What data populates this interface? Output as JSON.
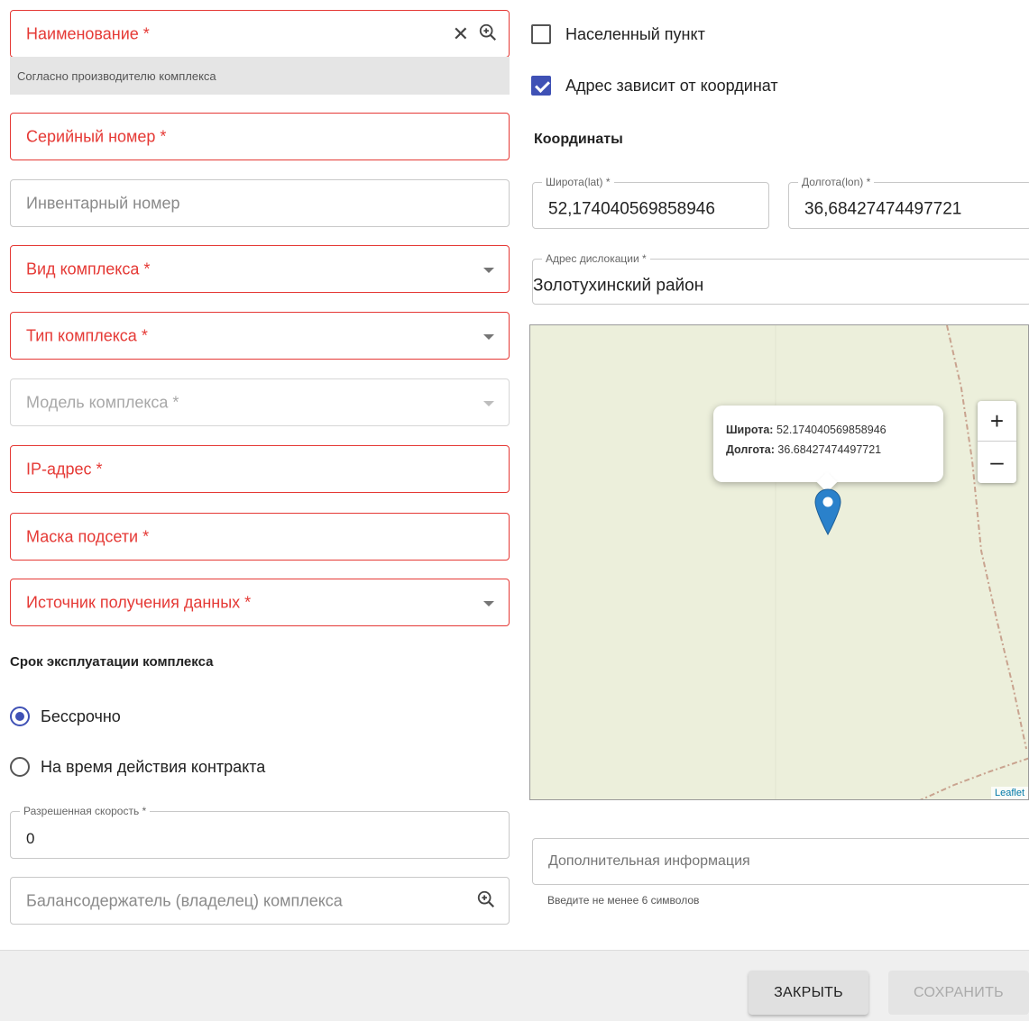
{
  "left": {
    "name": {
      "placeholder": "Наименование *",
      "clear_icon": "close-icon",
      "search_icon": "zoom-in-icon"
    },
    "name_helper": "Согласно производителю комплекса",
    "serial": {
      "placeholder": "Серийный номер *"
    },
    "inventory": {
      "placeholder": "Инвентарный номер"
    },
    "kind": {
      "placeholder": "Вид комплекса *"
    },
    "type": {
      "placeholder": "Тип комплекса *"
    },
    "model": {
      "placeholder": "Модель комплекса *"
    },
    "ip": {
      "placeholder": "IP-адрес *"
    },
    "mask": {
      "placeholder": "Маска подсети *"
    },
    "source": {
      "placeholder": "Источник получения данных *"
    },
    "term_title": "Срок эксплуатации комплекса",
    "term_options": [
      {
        "label": "Бессрочно",
        "selected": true
      },
      {
        "label": "На время действия контракта",
        "selected": false
      }
    ],
    "speed": {
      "label": "Разрешенная скорость *",
      "value": "0"
    },
    "owner": {
      "placeholder": "Балансодержатель (владелец) комплекса",
      "search_icon": "zoom-in-icon"
    }
  },
  "right": {
    "locality": {
      "label": "Населенный пункт",
      "checked": false
    },
    "address_by_coords": {
      "label": "Адрес зависит от координат",
      "checked": true
    },
    "coords_title": "Координаты",
    "lat": {
      "label": "Широта(lat) *",
      "value": "52,174040569858946"
    },
    "lon": {
      "label": "Долгота(lon) *",
      "value": "36,68427474497721"
    },
    "address": {
      "label": "Адрес дислокации *",
      "value": "Золотухинский район"
    },
    "map": {
      "popup_lat_label": "Широта:",
      "popup_lat_value": "52.174040569858946",
      "popup_lon_label": "Долгота:",
      "popup_lon_value": "36.68427474497721",
      "zoom_in": "+",
      "zoom_out": "–",
      "attribution": "Leaflet",
      "marker_color": "#2a81cb"
    },
    "extra": {
      "placeholder": "Дополнительная информация",
      "helper": "Введите не менее 6 символов"
    }
  },
  "footer": {
    "close_label": "ЗАКРЫТЬ",
    "save_label": "СОХРАНИТЬ"
  },
  "colors": {
    "error": "#e53935",
    "accent": "#3f51b5"
  }
}
